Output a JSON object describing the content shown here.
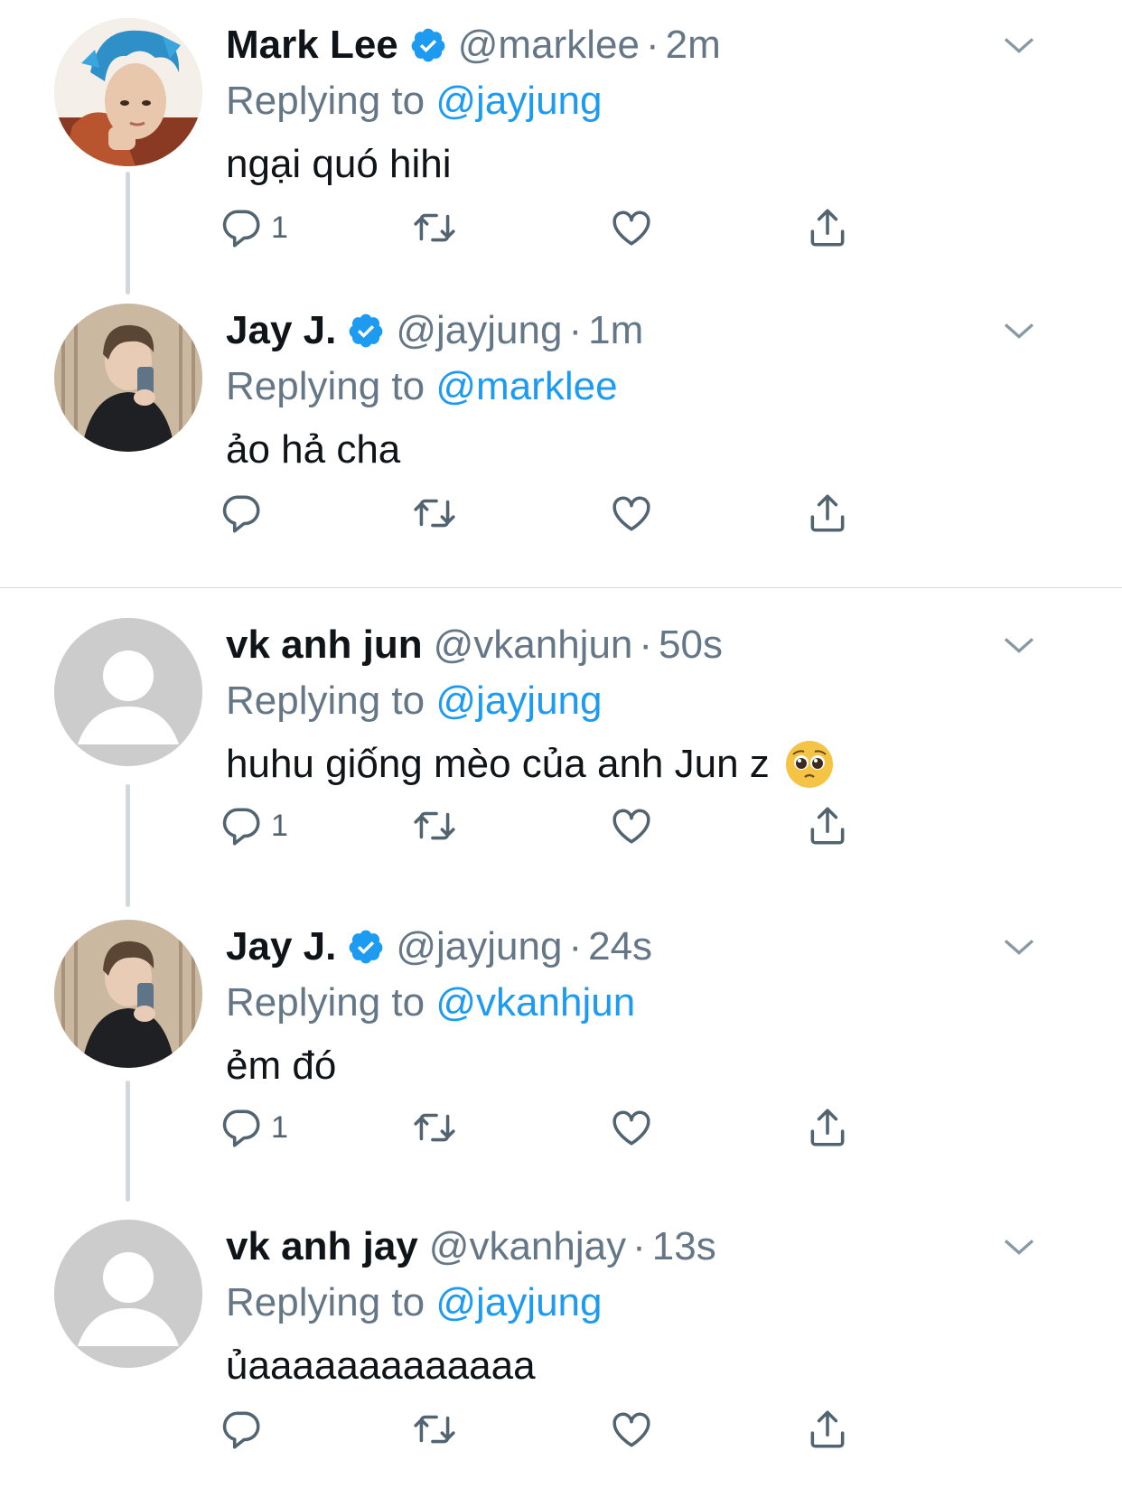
{
  "colors": {
    "accent": "#1d9bf0",
    "secondary_text": "#657786",
    "primary_text": "#0f1419",
    "thread_line": "#cfd9de",
    "divider": "#d9d9d9"
  },
  "replying_prefix": "Replying to",
  "dot_separator": "·",
  "tweets": [
    {
      "name": "Mark Lee",
      "verified": true,
      "handle": "@marklee",
      "time": "2m",
      "replying_to": "@jayjung",
      "text": "ngại quó hihi",
      "reply_count": "1",
      "avatar": "photo-blue-hair",
      "icons": [
        "reply-icon",
        "retweet-icon",
        "like-icon",
        "share-icon",
        "chevron-down-icon"
      ]
    },
    {
      "name": "Jay J.",
      "verified": true,
      "handle": "@jayjung",
      "time": "1m",
      "replying_to": "@marklee",
      "text": "ảo hả cha",
      "reply_count": "",
      "avatar": "photo-mirror-selfie"
    },
    {
      "name": "vk anh jun",
      "verified": false,
      "handle": "@vkanhjun",
      "time": "50s",
      "replying_to": "@jayjung",
      "text": "huhu giống mèo của anh Jun z",
      "emoji": "pleading-face-emoji",
      "reply_count": "1",
      "avatar": "default-avatar"
    },
    {
      "name": "Jay J.",
      "verified": true,
      "handle": "@jayjung",
      "time": "24s",
      "replying_to": "@vkanhjun",
      "text": "ẻm đó",
      "reply_count": "1",
      "avatar": "photo-mirror-selfie"
    },
    {
      "name": "vk anh jay",
      "verified": false,
      "handle": "@vkanhjay",
      "time": "13s",
      "replying_to": "@jayjung",
      "text": "ủaaaaaaaaaaaaa",
      "reply_count": "",
      "avatar": "default-avatar"
    }
  ]
}
